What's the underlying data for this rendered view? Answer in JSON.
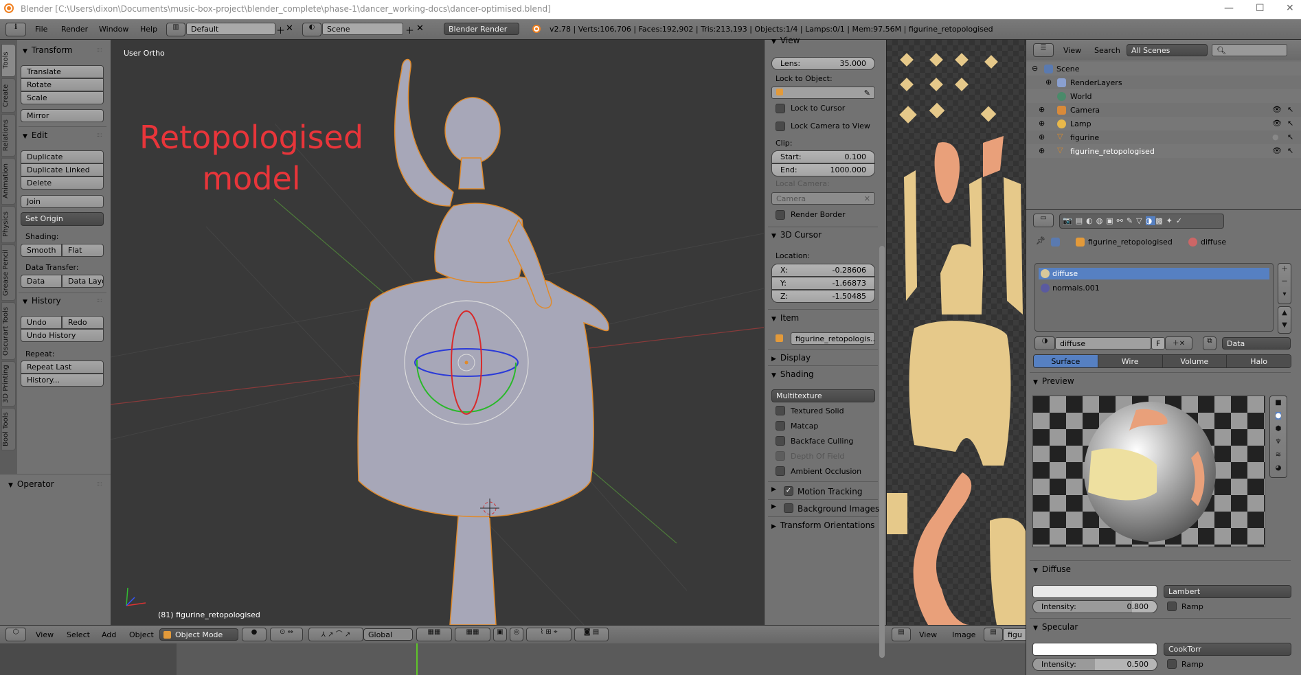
{
  "window": {
    "title": "Blender [C:\\Users\\dixon\\Documents\\music-box-project\\blender_complete\\phase-1\\dancer_working-docs\\dancer-optimised.blend]",
    "controls": [
      "—",
      "☐",
      "✕"
    ]
  },
  "info_header": {
    "menus": [
      "File",
      "Render",
      "Window",
      "Help"
    ],
    "layout": "Default",
    "scene": "Scene",
    "engine": "Blender Render",
    "stats": "v2.78 | Verts:106,706 | Faces:192,902 | Tris:213,193 | Objects:1/4 | Lamps:0/1 | Mem:97.56M | figurine_retopologised"
  },
  "tool_tabs": [
    "Tools",
    "Create",
    "Relations",
    "Animation",
    "Physics",
    "Grease Pencil",
    "Oscurart Tools",
    "3D Printing",
    "Bool Tools"
  ],
  "tools": {
    "transform": {
      "title": "Transform",
      "buttons": [
        "Translate",
        "Rotate",
        "Scale",
        "Mirror"
      ]
    },
    "edit": {
      "title": "Edit",
      "buttons": [
        "Duplicate",
        "Duplicate Linked",
        "Delete",
        "Join"
      ],
      "set_origin": "Set Origin",
      "shading_label": "Shading:",
      "smooth": "Smooth",
      "flat": "Flat",
      "data_transfer_label": "Data Transfer:",
      "data": "Data",
      "data_layout": "Data Layo"
    },
    "history": {
      "title": "History",
      "undo": "Undo",
      "redo": "Redo",
      "undo_history": "Undo History",
      "repeat_label": "Repeat:",
      "repeat_last": "Repeat Last",
      "history": "History..."
    },
    "operator": "Operator"
  },
  "viewport": {
    "view_name": "User Ortho",
    "annotation_line1": "Retopologised",
    "annotation_line2": "model",
    "annotation_color": "#e8353a",
    "object_info": "(81) figurine_retopologised"
  },
  "view3d_header": {
    "menus": [
      "View",
      "Select",
      "Add",
      "Object"
    ],
    "mode": "Object Mode",
    "orientation": "Global"
  },
  "npanel": {
    "view_title": "View",
    "lens_label": "Lens:",
    "lens": "35.000",
    "lock_to_object": "Lock to Object:",
    "lock_to_cursor": "Lock to Cursor",
    "lock_camera": "Lock Camera to View",
    "clip": "Clip:",
    "start_label": "Start:",
    "start": "0.100",
    "end_label": "End:",
    "end": "1000.000",
    "local_camera": "Local Camera:",
    "camera": "Camera",
    "render_border": "Render Border",
    "cursor_title": "3D Cursor",
    "location": "Location:",
    "x_label": "X:",
    "x": "-0.28606",
    "y_label": "Y:",
    "y": "-1.66873",
    "z_label": "Z:",
    "z": "-1.50485",
    "item_title": "Item",
    "item_name": "figurine_retopologis...",
    "display_title": "Display",
    "shading_title": "Shading",
    "shading_mode": "Multitexture",
    "textured_solid": "Textured Solid",
    "matcap": "Matcap",
    "backface": "Backface Culling",
    "dof": "Depth Of Field",
    "ao": "Ambient Occlusion",
    "motion_tracking": "Motion Tracking",
    "motion_tracking_checked": true,
    "background_images": "Background Images",
    "transform_orientations": "Transform Orientations"
  },
  "image_editor_header": {
    "menus": [
      "View",
      "Image"
    ],
    "image": "figu"
  },
  "outliner": {
    "menus": [
      "View",
      "Search"
    ],
    "filter": "All Scenes",
    "items": [
      {
        "name": "Scene",
        "icon": "scene-icon"
      },
      {
        "name": "RenderLayers",
        "icon": "render-layers-icon"
      },
      {
        "name": "World",
        "icon": "world-icon"
      },
      {
        "name": "Camera",
        "icon": "camera-icon",
        "visible": true
      },
      {
        "name": "Lamp",
        "icon": "lamp-icon",
        "visible": true
      },
      {
        "name": "figurine",
        "icon": "mesh-icon",
        "visible": false
      },
      {
        "name": "figurine_retopologised",
        "icon": "mesh-icon",
        "visible": true
      }
    ]
  },
  "properties": {
    "breadcrumb_object": "figurine_retopologised",
    "breadcrumb_material": "diffuse",
    "slots": [
      "diffuse",
      "normals.001"
    ],
    "selected_slot": 0,
    "material_name": "diffuse",
    "fake_user": "F",
    "link": "Data",
    "tabs": [
      "Surface",
      "Wire",
      "Volume",
      "Halo"
    ],
    "active_tab": "Surface",
    "preview_title": "Preview",
    "diffuse_title": "Diffuse",
    "diffuse_shader": "Lambert",
    "intensity_label": "Intensity:",
    "diffuse_intensity": "0.800",
    "ramp": "Ramp",
    "specular_title": "Specular",
    "specular_shader": "CookTorr",
    "specular_intensity": "0.500",
    "accent": "#5680c2"
  }
}
